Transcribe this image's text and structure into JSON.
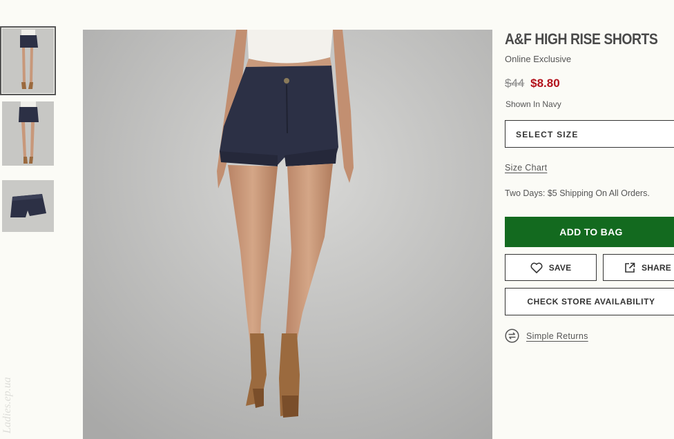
{
  "thumbnails": [
    {
      "icon": "model-front-thumbnail",
      "selected": true
    },
    {
      "icon": "model-back-thumbnail",
      "selected": false
    },
    {
      "icon": "shorts-flat-thumbnail",
      "selected": false
    }
  ],
  "main_image": {
    "icon": "model-wearing-shorts-photo"
  },
  "watermark": "Ladies.ep.ua",
  "product": {
    "name": "A&F HIGH RISE SHORTS",
    "subtitle": "Online Exclusive",
    "original_price": "$44",
    "sale_price": "$8.80",
    "color_text": "Shown In Navy"
  },
  "size_select": {
    "label": "SELECT SIZE"
  },
  "size_chart_link": "Size Chart",
  "shipping_text": "Two Days: $5 Shipping On All Orders.",
  "buttons": {
    "add_to_bag": "ADD TO BAG",
    "save": "SAVE",
    "share": "SHARE",
    "check_store": "CHECK STORE AVAILABILITY"
  },
  "returns_link": "Simple Returns",
  "colors": {
    "background": "#fbfbf6",
    "add_to_bag_bg": "#136a1f",
    "sale_price": "#b3121b",
    "shorts_navy": "#2c3045"
  }
}
